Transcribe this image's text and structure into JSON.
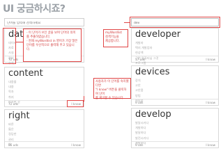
{
  "title": "UI 궁금하시죠?",
  "search_left": {
    "placeholder": "단어를 입력해 검색하세요"
  },
  "search_right": {
    "value": "dev"
  },
  "cards": {
    "data": {
      "word": "data",
      "items": [
        "데이터",
        "자료",
        "사실",
        "정보",
        "수치"
      ],
      "count": "72 uds",
      "know_label": "I know"
    },
    "content": {
      "word": "content",
      "items": [
        "내용물",
        "내용",
        "목차",
        "취지",
        "만족한 것"
      ],
      "count": "72 uds",
      "know_label": "I know"
    },
    "right": {
      "word": "right",
      "items": [
        "바른",
        "옳은",
        "정당한",
        "권리",
        "딱"
      ],
      "count": "86 uds",
      "know_label": "I know"
    },
    "developer": {
      "word": "developer",
      "items": [
        "개발자",
        "택지 개발업자",
        "현상액",
        "근면 컴퓨터님 그것",
        "프로그램"
      ],
      "count": "17 uds",
      "know_label": "I know"
    },
    "devices": {
      "word": "devices",
      "items": [
        "장치",
        "고안",
        "고안품",
        "방법",
        "희망품"
      ],
      "count": "9 uds",
      "know_label": "I know"
    },
    "develop": {
      "word": "develop",
      "items": [
        "발달시키다",
        "개발하다",
        "발달하다",
        "발전시키다",
        "계발하다"
      ],
      "count": "9 uds",
      "know_label": "I know"
    }
  },
  "callouts": {
    "wordlist": [
      "- 이 단어가 쓰인 글을 보며 단어의 의미를 추출하였습니다.",
      "- 현재 myWordlist in 영어가 가장 많은 단어를 우선적으로 출력해 주고 있습니다."
    ],
    "search": [
      "myWordlist",
      "검색기능을",
      "제공합니다."
    ],
    "know": [
      "사용자가 이 단어를 숙지했다면",
      "\"I know\" 버튼을 클릭하여 단어",
      "를 제거할 수 있습니다."
    ]
  },
  "colors": {
    "accent": "#e04444",
    "title": "#9aa0a6"
  }
}
